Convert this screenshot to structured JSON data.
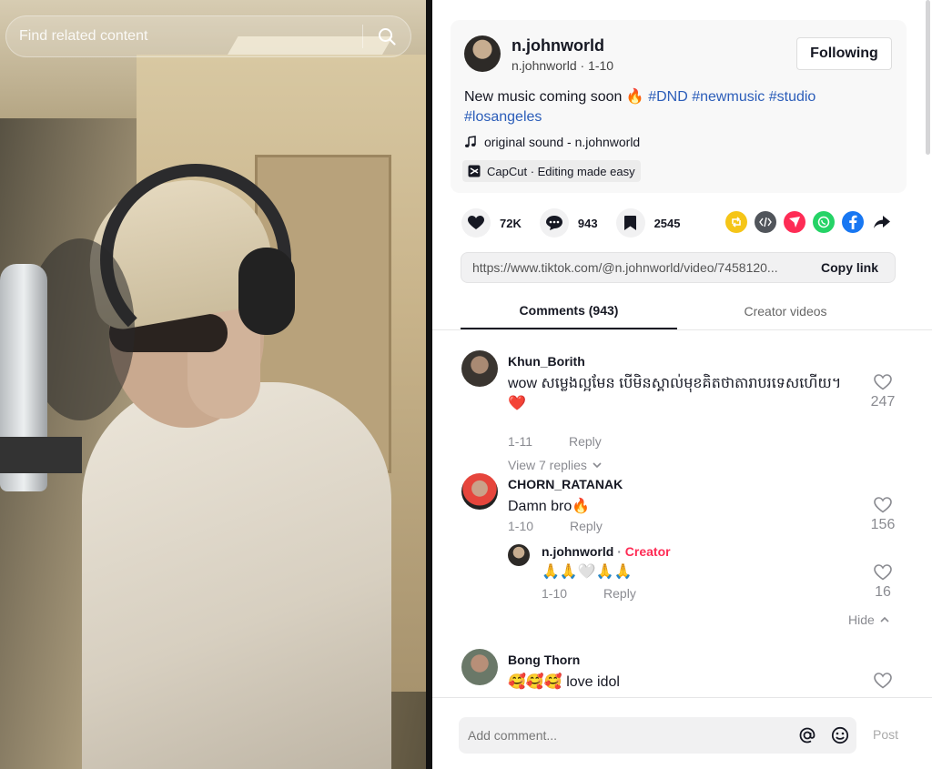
{
  "search": {
    "placeholder": "Find related content"
  },
  "post": {
    "username": "n.johnworld",
    "handle": "n.johnworld",
    "date": "1-10",
    "follow_label": "Following",
    "caption_text": "New music coming soon 🔥 ",
    "hashtags": [
      "#DND",
      "#newmusic",
      "#studio",
      "#losangeles"
    ],
    "sound": "original sound - n.johnworld",
    "capcut": "CapCut · Editing made easy"
  },
  "stats": {
    "likes": "72K",
    "comments": "943",
    "saves": "2545"
  },
  "share_colors": {
    "repost": "#f5c518",
    "embed": "#51555b",
    "send": "#fe2c55",
    "whatsapp": "#25d366",
    "facebook": "#1877f2"
  },
  "link": {
    "url": "https://www.tiktok.com/@n.johnworld/video/7458120...",
    "copy_label": "Copy link"
  },
  "tabs": {
    "comments": "Comments (943)",
    "creator": "Creator videos"
  },
  "comments": [
    {
      "name": "Khun_Borith",
      "text": "wow សម្លេងល្អមែន បើមិនស្គាល់មុខគិតថាតារាបរទេសហើយ។ ❤️",
      "date": "1-11",
      "reply_label": "Reply",
      "likes": "247",
      "view_replies": "View 7 replies"
    },
    {
      "name": "CHORN_RATANAK",
      "text": "Damn bro🔥",
      "date": "1-10",
      "reply_label": "Reply",
      "likes": "156",
      "reply": {
        "name": "n.johnworld",
        "badge": "Creator",
        "text": "🙏🙏🤍🙏🙏",
        "date": "1-10",
        "reply_label": "Reply",
        "likes": "16"
      },
      "hide_label": "Hide"
    },
    {
      "name": "Bong Thorn",
      "text": "🥰🥰🥰 love idol",
      "likes": ""
    }
  ],
  "footer": {
    "placeholder": "Add comment...",
    "post_label": "Post"
  }
}
